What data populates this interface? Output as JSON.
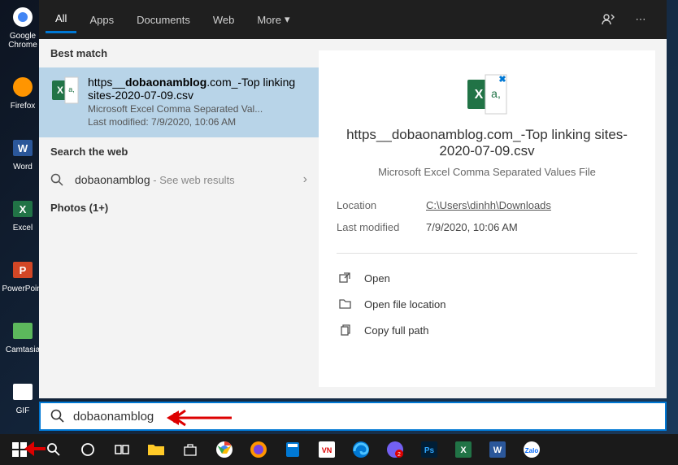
{
  "tabs": {
    "all": "All",
    "apps": "Apps",
    "documents": "Documents",
    "web": "Web",
    "more": "More"
  },
  "sections": {
    "best_match": "Best match",
    "search_web": "Search the web",
    "photos": "Photos (1+)"
  },
  "result": {
    "title_pre": "https__",
    "title_bold": "dobaonamblog",
    "title_post": ".com_-Top linking sites-2020-07-09.csv",
    "sub": "Microsoft Excel Comma Separated Val...",
    "modified": "Last modified: 7/9/2020, 10:06 AM"
  },
  "web": {
    "query": "dobaonamblog",
    "suffix": " - See web results"
  },
  "preview": {
    "title": "https__dobaonamblog.com_-Top linking sites-2020-07-09.csv",
    "subtitle": "Microsoft Excel Comma Separated Values File",
    "location_label": "Location",
    "location": "C:\\Users\\dinhh\\Downloads",
    "modified_label": "Last modified",
    "modified": "7/9/2020, 10:06 AM"
  },
  "actions": {
    "open": "Open",
    "location": "Open file location",
    "copy": "Copy full path"
  },
  "search": {
    "value": "dobaonamblog"
  },
  "desktop": {
    "chrome": "Google Chrome",
    "firefox": "Firefox",
    "word": "Word",
    "excel": "Excel",
    "ppt": "PowerPoint",
    "camtasia": "Camtasia",
    "gif": "GIF"
  }
}
